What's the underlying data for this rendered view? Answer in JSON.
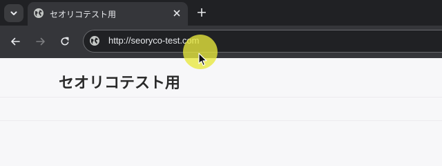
{
  "browser": {
    "tab": {
      "title": "セオリコテスト用"
    },
    "address_bar": {
      "url": "http://seoryco-test.com"
    }
  },
  "page": {
    "heading": "セオリコテスト用"
  },
  "colors": {
    "tabstrip": "#202124",
    "toolbar": "#35363a",
    "cursor_highlight": "#e8e83c"
  }
}
